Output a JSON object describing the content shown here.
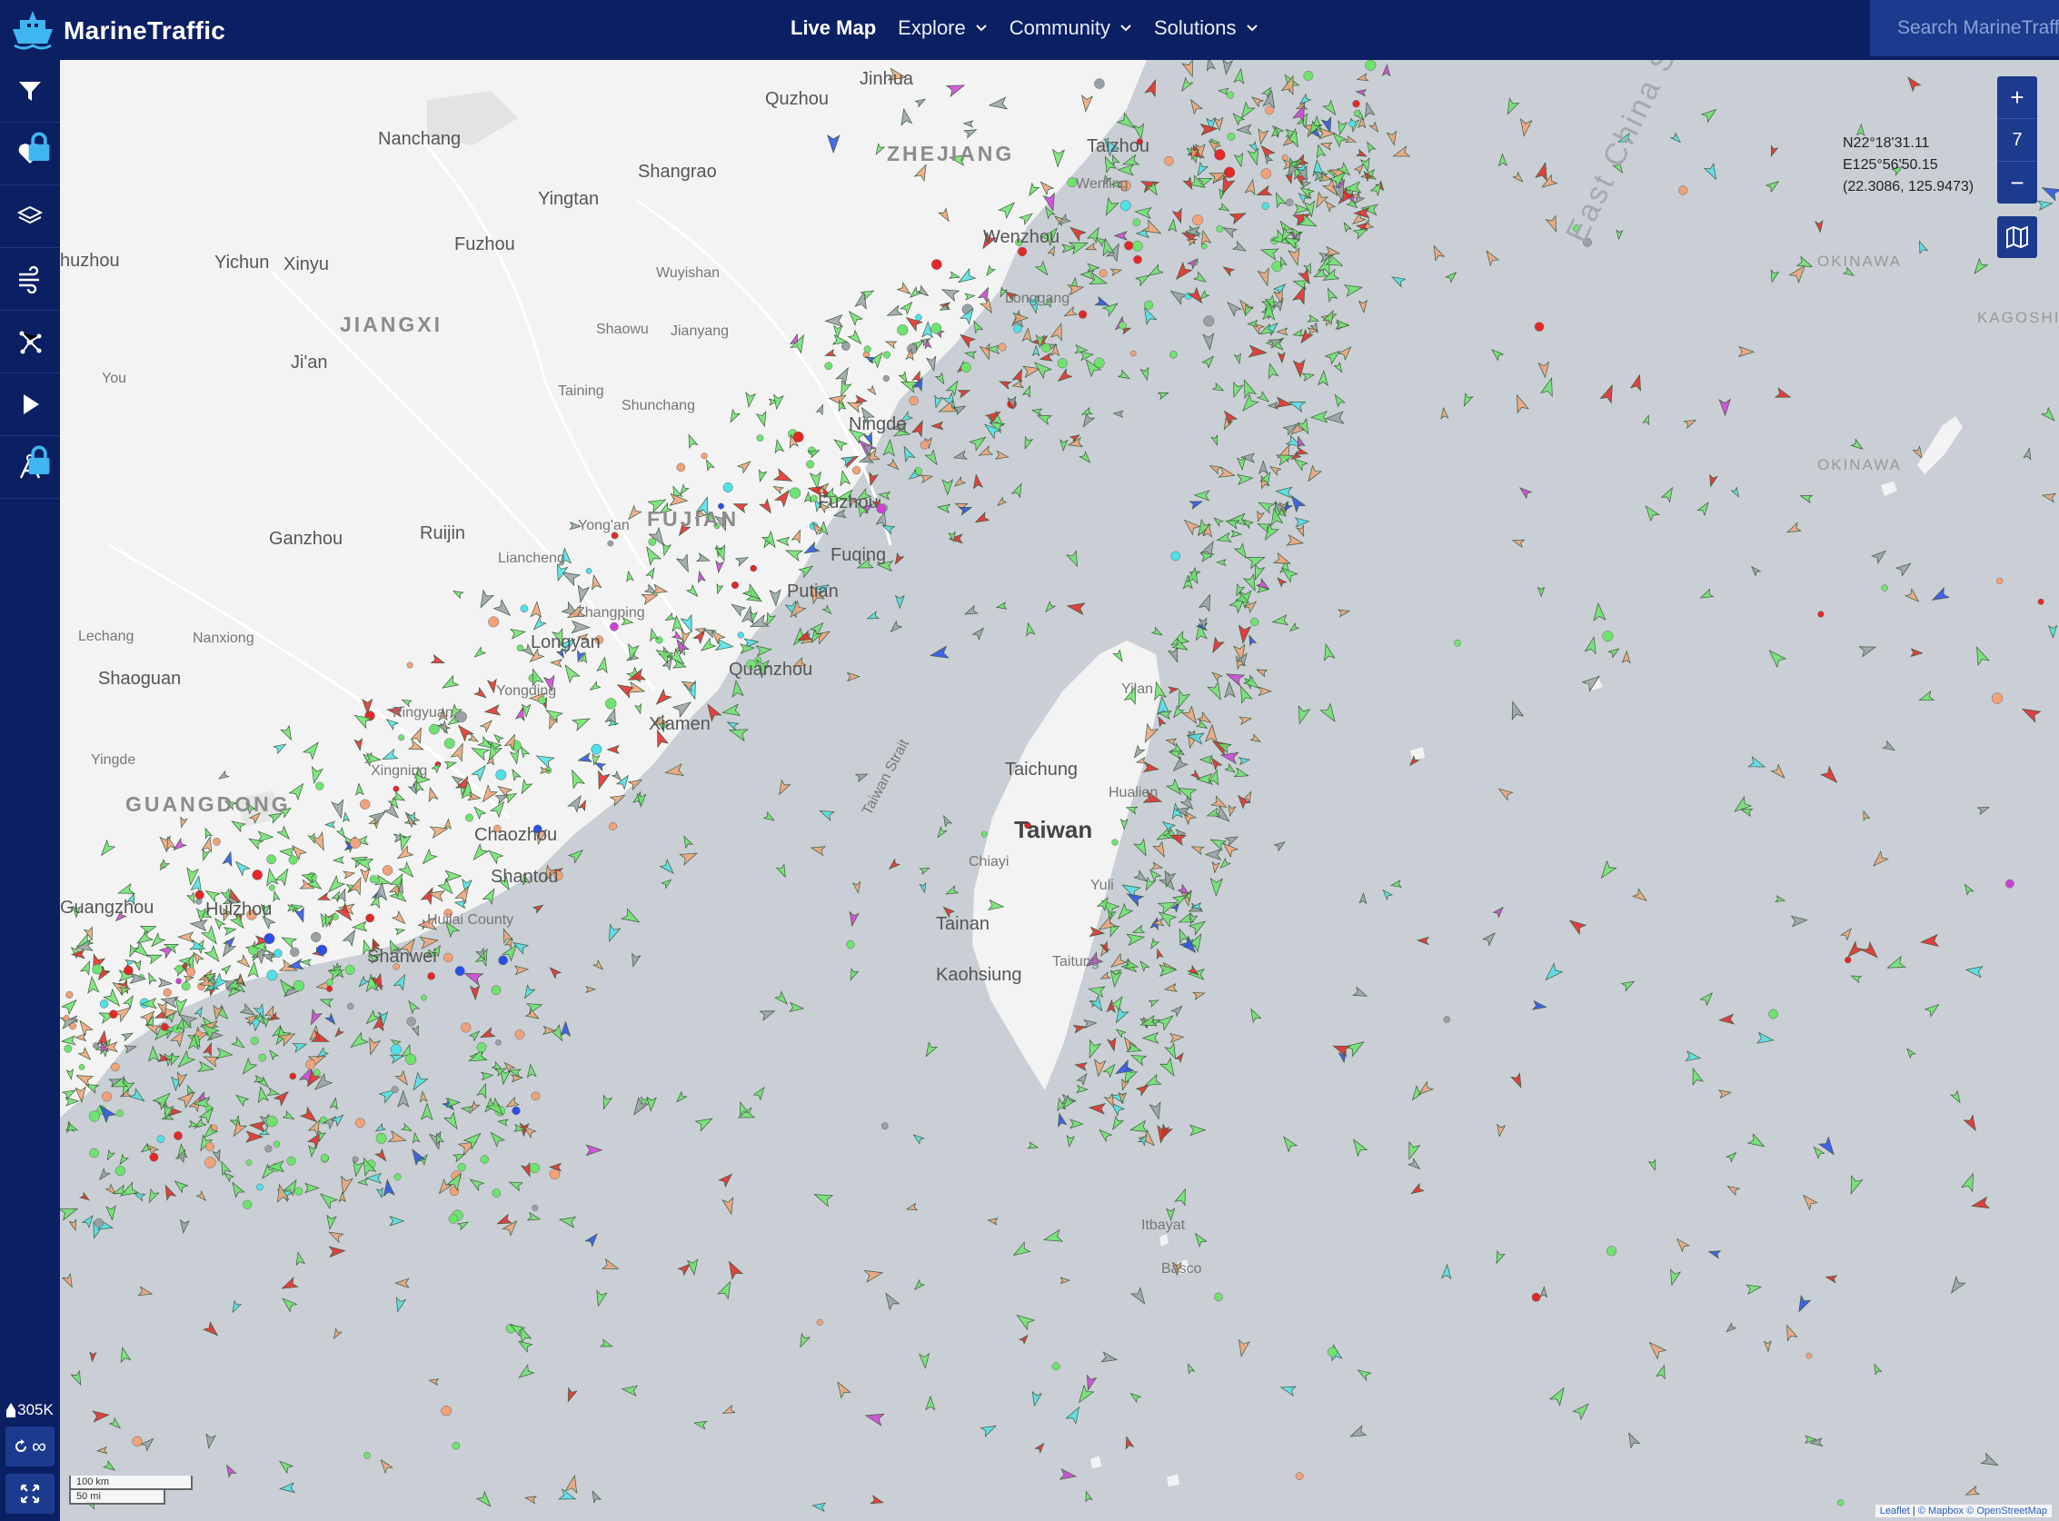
{
  "app": {
    "name": "MarineTraffic",
    "search_placeholder": "Search MarineTraffic"
  },
  "nav": [
    {
      "label": "Live Map",
      "active": true,
      "has_dropdown": false
    },
    {
      "label": "Explore",
      "active": false,
      "has_dropdown": true
    },
    {
      "label": "Community",
      "active": false,
      "has_dropdown": true
    },
    {
      "label": "Solutions",
      "active": false,
      "has_dropdown": true
    }
  ],
  "sidebar": {
    "items": [
      {
        "icon": "filter-icon",
        "locked": false
      },
      {
        "icon": "heart-icon",
        "locked": true
      },
      {
        "icon": "layers-icon",
        "locked": false
      },
      {
        "icon": "wind-icon",
        "locked": false
      },
      {
        "icon": "network-icon",
        "locked": false
      },
      {
        "icon": "play-icon",
        "locked": false
      },
      {
        "icon": "compass-icon",
        "locked": true
      }
    ],
    "vessel_count": "305K",
    "refresh_label": "∞"
  },
  "map": {
    "zoom_in": "+",
    "zoom_level": "7",
    "zoom_out": "−",
    "coordinates": {
      "lat": "N22°18'31.11",
      "lon": "E125°56'50.15",
      "decimal": "(22.3086, 125.9473)"
    },
    "scale": {
      "km": "100 km",
      "mi": "50 mi"
    },
    "attribution": {
      "leaflet": "Leaflet",
      "mapbox": "© Mapbox",
      "osm": "© OpenStreetMap"
    },
    "labels": [
      {
        "text": "Jinhua",
        "class": ""
      },
      {
        "text": "Quzhou",
        "class": ""
      },
      {
        "text": "Nanchang",
        "class": ""
      },
      {
        "text": "ZHEJIANG",
        "class": "prov"
      },
      {
        "text": "Shangrao",
        "class": ""
      },
      {
        "text": "Taizhou",
        "class": ""
      },
      {
        "text": "Wenling",
        "class": "small"
      },
      {
        "text": "Yingtan",
        "class": ""
      },
      {
        "text": "Fuzhou",
        "class": ""
      },
      {
        "text": "Wenzhou",
        "class": ""
      },
      {
        "text": "huzhou",
        "class": ""
      },
      {
        "text": "Yichun",
        "class": ""
      },
      {
        "text": "Xinyu",
        "class": ""
      },
      {
        "text": "Wuyishan",
        "class": "small"
      },
      {
        "text": "Longgang",
        "class": "small"
      },
      {
        "text": "JIANGXI",
        "class": "prov"
      },
      {
        "text": "Shaowu",
        "class": "small"
      },
      {
        "text": "Jianyang",
        "class": "small"
      },
      {
        "text": "Ji'an",
        "class": ""
      },
      {
        "text": "You",
        "class": "small"
      },
      {
        "text": "Taining",
        "class": "small"
      },
      {
        "text": "Shunchang",
        "class": "small"
      },
      {
        "text": "Ningde",
        "class": ""
      },
      {
        "text": "Fuzhou",
        "class": ""
      },
      {
        "text": "Ganzhou",
        "class": ""
      },
      {
        "text": "Ruijin",
        "class": ""
      },
      {
        "text": "Yong'an",
        "class": "small"
      },
      {
        "text": "FUJIAN",
        "class": "prov"
      },
      {
        "text": "Fuqing",
        "class": ""
      },
      {
        "text": "Liancheng",
        "class": "small"
      },
      {
        "text": "Putian",
        "class": ""
      },
      {
        "text": "Zhangping",
        "class": "small"
      },
      {
        "text": "Lechang",
        "class": "small"
      },
      {
        "text": "Nanxiong",
        "class": "small"
      },
      {
        "text": "Longyan",
        "class": ""
      },
      {
        "text": "Shaoguan",
        "class": ""
      },
      {
        "text": "Quanzhou",
        "class": ""
      },
      {
        "text": "Yongding",
        "class": "small"
      },
      {
        "text": "Pingyuan",
        "class": "small"
      },
      {
        "text": "Xiamen",
        "class": ""
      },
      {
        "text": "Yingde",
        "class": "small"
      },
      {
        "text": "Xingning",
        "class": "small"
      },
      {
        "text": "GUANGDONG",
        "class": "prov"
      },
      {
        "text": "Chaozhou",
        "class": ""
      },
      {
        "text": "Shantou",
        "class": ""
      },
      {
        "text": "Guangzhou",
        "class": ""
      },
      {
        "text": "Huizhou",
        "class": ""
      },
      {
        "text": "Huilai County",
        "class": "small"
      },
      {
        "text": "Shanwei",
        "class": ""
      },
      {
        "text": "Yilan",
        "class": "small"
      },
      {
        "text": "Taichung",
        "class": ""
      },
      {
        "text": "Hualien",
        "class": "small"
      },
      {
        "text": "Taiwan",
        "class": "big"
      },
      {
        "text": "Chiayi",
        "class": "small"
      },
      {
        "text": "Yuli",
        "class": "small"
      },
      {
        "text": "Tainan",
        "class": ""
      },
      {
        "text": "Kaohsiung",
        "class": ""
      },
      {
        "text": "Taitung",
        "class": "small"
      },
      {
        "text": "Taiwan Strait",
        "class": "small"
      },
      {
        "text": "Itbayat",
        "class": "small"
      },
      {
        "text": "Basco",
        "class": "small"
      },
      {
        "text": "OKINAWA",
        "class": "pref"
      },
      {
        "text": "OKINAWA",
        "class": "pref"
      },
      {
        "text": "KAGOSHIMA",
        "class": "pref"
      },
      {
        "text": "East China Sea",
        "class": "sea"
      }
    ]
  },
  "colors": {
    "nav_bg": "#0b1f63",
    "accent": "#1c3b8e",
    "cargo_green": "#6fe36f",
    "tanker_red": "#e42727",
    "passenger_blue": "#2a4fe8",
    "tug_cyan": "#4fe0e8",
    "fishing_salmon": "#f0a27a",
    "unknown_grey": "#9aa1a6",
    "pleasure_magenta": "#d040d8",
    "land": "#f3f3f3",
    "water": "#c9cfd4"
  }
}
